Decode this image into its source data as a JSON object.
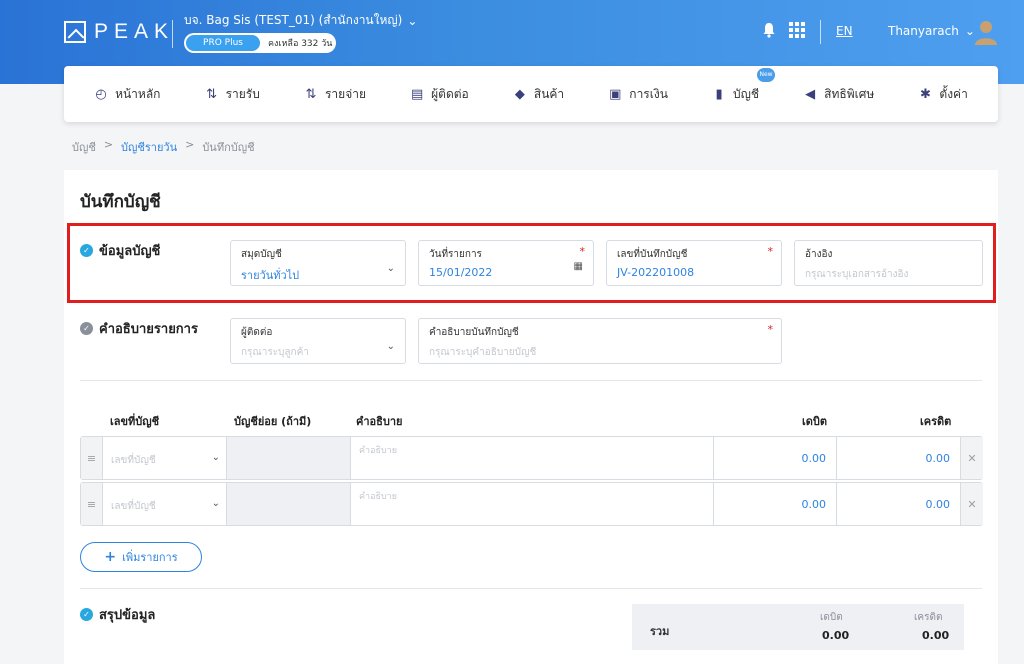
{
  "header": {
    "logo_text": "PEAK",
    "company": "บจ. Bag Sis (TEST_01) (สำนักงานใหญ่)",
    "plan": "PRO Plus",
    "remaining": "คงเหลือ 332 วัน",
    "language": "EN",
    "user": "Thanyarach"
  },
  "nav": {
    "items": [
      {
        "label": "หน้าหลัก",
        "icon": "dashboard-icon"
      },
      {
        "label": "รายรับ",
        "icon": "income-icon"
      },
      {
        "label": "รายจ่าย",
        "icon": "expense-icon"
      },
      {
        "label": "ผู้ติดต่อ",
        "icon": "contacts-icon"
      },
      {
        "label": "สินค้า",
        "icon": "box-icon"
      },
      {
        "label": "การเงิน",
        "icon": "money-icon"
      },
      {
        "label": "บัญชี",
        "icon": "ledger-icon"
      },
      {
        "label": "สิทธิพิเศษ",
        "icon": "megaphone-icon"
      },
      {
        "label": "ตั้งค่า",
        "icon": "gear-icon"
      }
    ],
    "new_badge": "New"
  },
  "breadcrumb": {
    "root": "บัญชี",
    "sep1": ">",
    "daily": "บัญชีรายวัน",
    "sep2": ">",
    "current": "บันทึกบัญชี"
  },
  "page": {
    "title": "บันทึกบัญชี"
  },
  "account_info": {
    "label": "ข้อมูลบัญชี",
    "journal_label": "สมุดบัญชี",
    "journal_value": "รายวันทั่วไป",
    "date_label": "วันที่รายการ",
    "date_value": "15/01/2022",
    "doc_no_label": "เลขที่บันทึกบัญชี",
    "doc_no_value": "JV-202201008",
    "ref_label": "อ้างอิง",
    "ref_placeholder": "กรุณาระบุเอกสารอ้างอิง"
  },
  "description_section": {
    "label": "คำอธิบายรายการ",
    "contact_label": "ผู้ติดต่อ",
    "contact_placeholder": "กรุณาระบุลูกค้า",
    "desc_label": "คำอธิบายบันทึกบัญชี",
    "desc_placeholder": "กรุณาระบุคำอธิบายบัญชี"
  },
  "table": {
    "headers": {
      "account": "เลขที่บัญชี",
      "sub": "บัญชีย่อย (ถ้ามี)",
      "desc": "คำอธิบาย",
      "debit": "เดบิต",
      "credit": "เครดิต"
    },
    "rows": [
      {
        "account_placeholder": "เลขที่บัญชี",
        "desc_placeholder": "คำอธิบาย",
        "debit": "0.00",
        "credit": "0.00"
      },
      {
        "account_placeholder": "เลขที่บัญชี",
        "desc_placeholder": "คำอธิบาย",
        "debit": "0.00",
        "credit": "0.00"
      }
    ],
    "add_label": "เพิ่มรายการ"
  },
  "summary": {
    "label": "สรุปข้อมูล",
    "total_label": "รวม",
    "debit_label": "เดบิต",
    "credit_label": "เครดิต",
    "debit_total": "0.00",
    "credit_total": "0.00"
  },
  "colors": {
    "accent": "#2f84e0",
    "highlight": "#e11d1d",
    "check": "#29a7df"
  }
}
